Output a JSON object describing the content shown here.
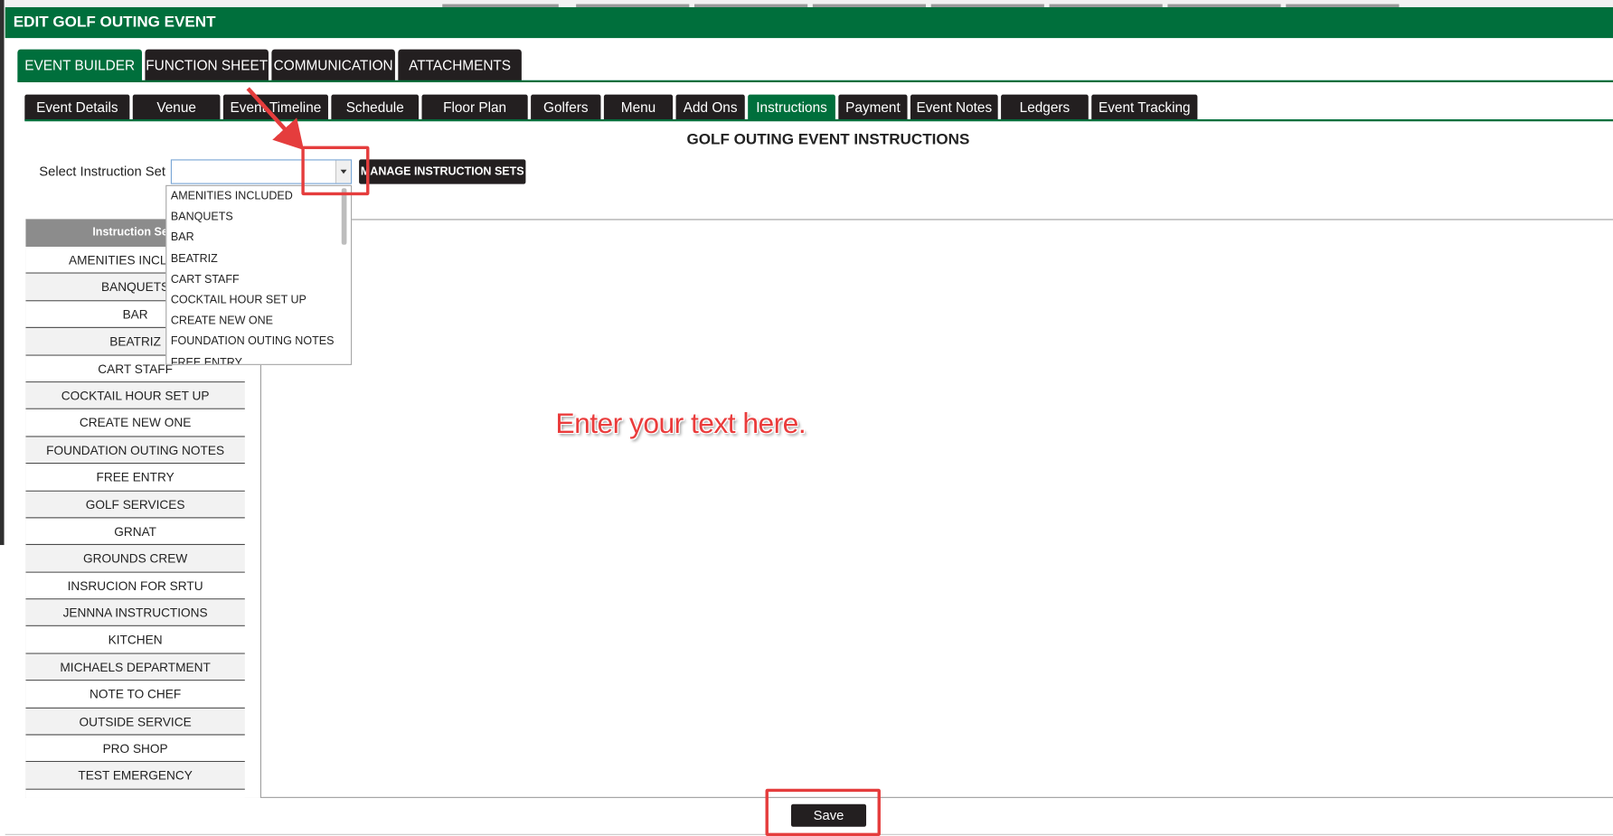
{
  "window": {
    "title": "EDIT GOLF OUTING EVENT"
  },
  "main_tabs": [
    {
      "label": "EVENT BUILDER",
      "active": true
    },
    {
      "label": "FUNCTION SHEET",
      "active": false
    },
    {
      "label": "COMMUNICATION",
      "active": false
    },
    {
      "label": "ATTACHMENTS",
      "active": false
    }
  ],
  "sub_tabs": [
    {
      "label": "Event Details",
      "active": false
    },
    {
      "label": "Venue",
      "active": false
    },
    {
      "label": "Event Timeline",
      "active": false
    },
    {
      "label": "Schedule",
      "active": false
    },
    {
      "label": "Floor Plan",
      "active": false
    },
    {
      "label": "Golfers",
      "active": false
    },
    {
      "label": "Menu",
      "active": false
    },
    {
      "label": "Add Ons",
      "active": false
    },
    {
      "label": "Instructions",
      "active": true
    },
    {
      "label": "Payment",
      "active": false
    },
    {
      "label": "Event Notes",
      "active": false
    },
    {
      "label": "Ledgers",
      "active": false
    },
    {
      "label": "Event Tracking",
      "active": false
    }
  ],
  "page": {
    "heading": "GOLF OUTING EVENT INSTRUCTIONS",
    "select_label": "Select Instruction Set",
    "select_value": "",
    "manage_button": "MANAGE INSTRUCTION SETS"
  },
  "dropdown_options": [
    "AMENITIES INCLUDED",
    "BANQUETS",
    "BAR",
    "BEATRIZ",
    "CART STAFF",
    "COCKTAIL HOUR SET UP",
    "CREATE NEW ONE",
    "FOUNDATION OUTING NOTES",
    "FREE ENTRY"
  ],
  "instruction_list": {
    "header": "Instruction Sets",
    "items": [
      "AMENITIES INCLUDED",
      "BANQUETS",
      "BAR",
      "BEATRIZ",
      "CART STAFF",
      "COCKTAIL HOUR SET UP",
      "CREATE NEW ONE",
      "FOUNDATION OUTING NOTES",
      "FREE ENTRY",
      "GOLF SERVICES",
      "GRNAT",
      "GROUNDS CREW",
      "INSRUCION FOR SRTU",
      "JENNNA INSTRUCTIONS",
      "KITCHEN",
      "MICHAELS DEPARTMENT",
      "NOTE TO CHEF",
      "OUTSIDE SERVICE",
      "PRO SHOP",
      "TEST EMERGENCY",
      ""
    ]
  },
  "editor": {
    "hint": "Enter your text here."
  },
  "footer": {
    "save_label": "Save"
  },
  "annotation_color": "#e53d3d",
  "brand_color": "#006f3c"
}
